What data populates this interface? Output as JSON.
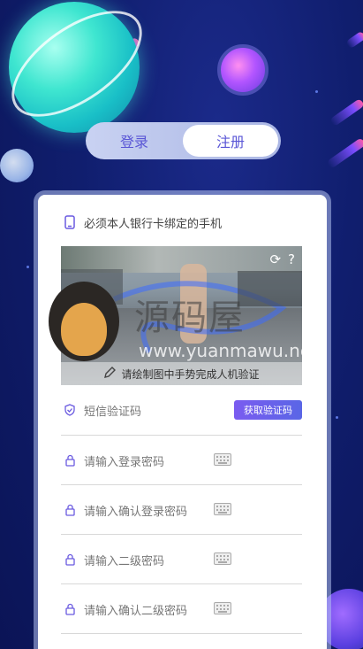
{
  "tabs": {
    "login": "登录",
    "register": "注册",
    "active": "register"
  },
  "form": {
    "phone_hint": "必须本人银行卡绑定的手机",
    "captcha_hint": "请绘制图中手势完成人机验证",
    "sms_placeholder": "短信验证码",
    "get_code_button": "获取验证码",
    "login_password": "请输入登录密码",
    "confirm_login_password": "请输入确认登录密码",
    "secondary_password": "请输入二级密码",
    "confirm_secondary_password": "请输入确认二级密码"
  },
  "watermark": {
    "text": "源码屋",
    "url": "www.yuanmawu.net"
  },
  "icons": [
    "phone-icon",
    "refresh-icon",
    "help-icon",
    "pencil-icon",
    "shield-icon",
    "lock-icon",
    "keyboard-icon"
  ],
  "colors": {
    "accent": "#5a56d6",
    "button_gradient_start": "#7a5cf0",
    "button_gradient_end": "#5a66e6",
    "background": "#101e6e"
  }
}
